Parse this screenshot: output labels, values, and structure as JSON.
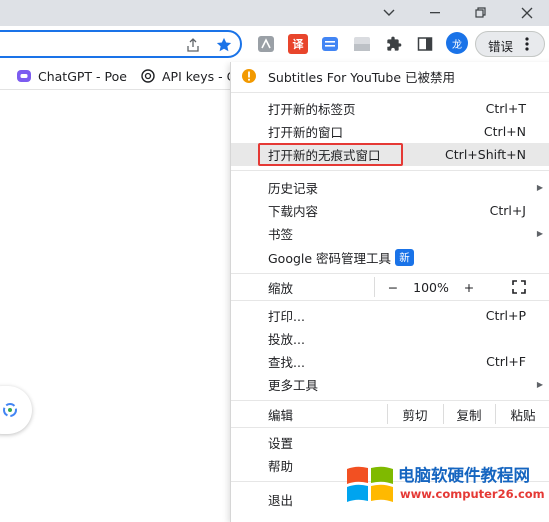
{
  "toolbar": {
    "profile_initial": "龙",
    "error_label": "错误",
    "ext_translate_label": "译"
  },
  "bookmarks": [
    {
      "label": "ChatGPT - Poe"
    },
    {
      "label": "API keys - C"
    }
  ],
  "menu": {
    "notice": "Subtitles For YouTube 已被禁用",
    "items_group1": [
      {
        "label": "打开新的标签页",
        "shortcut": "Ctrl+T"
      },
      {
        "label": "打开新的窗口",
        "shortcut": "Ctrl+N"
      },
      {
        "label": "打开新的无痕式窗口",
        "shortcut": "Ctrl+Shift+N"
      }
    ],
    "items_group2": [
      {
        "label": "历史记录",
        "shortcut": ""
      },
      {
        "label": "下载内容",
        "shortcut": "Ctrl+J"
      },
      {
        "label": "书签",
        "shortcut": ""
      },
      {
        "label": "Google 密码管理工具",
        "shortcut": "",
        "badge": "新"
      }
    ],
    "zoom": {
      "label": "缩放",
      "minus": "−",
      "value": "100%",
      "plus": "+"
    },
    "items_group3": [
      {
        "label": "打印...",
        "shortcut": "Ctrl+P"
      },
      {
        "label": "投放...",
        "shortcut": ""
      },
      {
        "label": "查找...",
        "shortcut": "Ctrl+F"
      },
      {
        "label": "更多工具",
        "shortcut": ""
      }
    ],
    "edit": {
      "label": "编辑",
      "cut": "剪切",
      "copy": "复制",
      "paste": "粘贴"
    },
    "items_group4": [
      {
        "label": "设置"
      },
      {
        "label": "帮助"
      }
    ],
    "exit": {
      "label": "退出"
    }
  },
  "watermark": {
    "title": "电脑软硬件教程网",
    "url": "www.computer26.com"
  },
  "colors": {
    "accent": "#1a73e8",
    "highlight_border": "#e53935",
    "watermark_title": "#1565c0",
    "watermark_url": "#e53935"
  }
}
